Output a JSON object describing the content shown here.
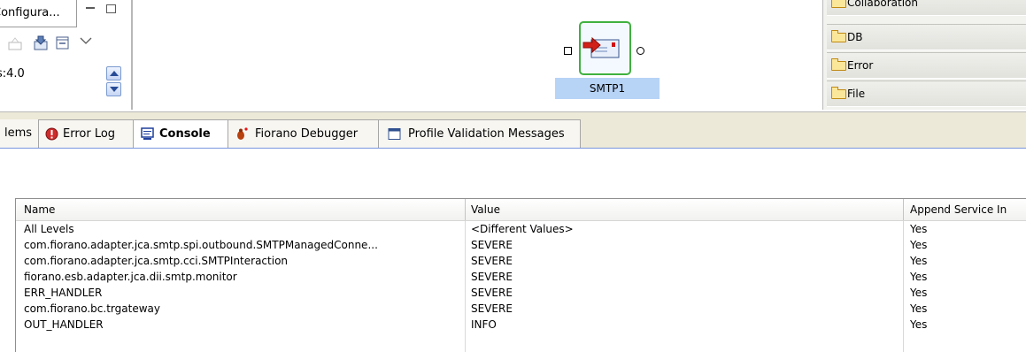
{
  "left_panel": {
    "config_tab_label": "Configura...",
    "version_value": "s:4.0"
  },
  "canvas": {
    "node_label": "SMTP1"
  },
  "palette": {
    "items": [
      {
        "label": "Collaboration"
      },
      {
        "label": "DB"
      },
      {
        "label": "Error"
      },
      {
        "label": "File"
      }
    ]
  },
  "tabs": [
    {
      "label": "Problems",
      "visible_label": "lems"
    },
    {
      "label": "Error Log"
    },
    {
      "label": "Console"
    },
    {
      "label": "Fiorano Debugger"
    },
    {
      "label": "Profile Validation Messages"
    }
  ],
  "table": {
    "columns": [
      "Name",
      "Value",
      "Append Service In"
    ],
    "rows": [
      {
        "name": "All Levels",
        "value": "<Different Values>",
        "append": "Yes"
      },
      {
        "name": "com.fiorano.adapter.jca.smtp.spi.outbound.SMTPManagedConne...",
        "value": "SEVERE",
        "append": "Yes"
      },
      {
        "name": "com.fiorano.adapter.jca.smtp.cci.SMTPInteraction",
        "value": "SEVERE",
        "append": "Yes"
      },
      {
        "name": "fiorano.esb.adapter.jca.dii.smtp.monitor",
        "value": "SEVERE",
        "append": "Yes"
      },
      {
        "name": "ERR_HANDLER",
        "value": "SEVERE",
        "append": "Yes"
      },
      {
        "name": "com.fiorano.bc.trgateway",
        "value": "SEVERE",
        "append": "Yes"
      },
      {
        "name": "OUT_HANDLER",
        "value": "INFO",
        "append": "Yes"
      }
    ]
  }
}
